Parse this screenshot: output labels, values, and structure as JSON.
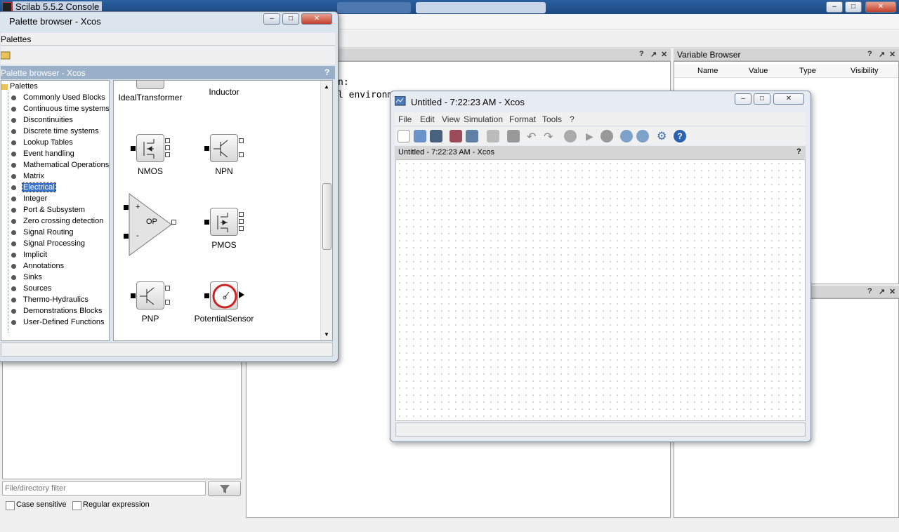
{
  "console": {
    "title": "Scilab 5.5.2 Console",
    "console_text_line1": "n:",
    "console_text_line2": "l environm",
    "variable_browser": {
      "title": "Variable Browser",
      "columns": [
        "Name",
        "Value",
        "Type",
        "Visibility"
      ]
    },
    "file_filter_placeholder": "File/directory filter",
    "case_sensitive_label": "Case sensitive",
    "regex_label": "Regular expression",
    "dock_help": "?",
    "dock_undock": "↗",
    "dock_close": "✕"
  },
  "palette_browser": {
    "title": "Palette browser - Xcos",
    "menu_label": "Palettes",
    "panel_title": "Palette browser - Xcos",
    "help": "?",
    "tree_root": "Palettes",
    "tree_items": [
      "Commonly Used Blocks",
      "Continuous time systems",
      "Discontinuities",
      "Discrete time systems",
      "Lookup Tables",
      "Event handling",
      "Mathematical Operations",
      "Matrix",
      "Electrical",
      "Integer",
      "Port & Subsystem",
      "Zero crossing detection",
      "Signal Routing",
      "Signal Processing",
      "Implicit",
      "Annotations",
      "Sinks",
      "Sources",
      "Thermo-Hydraulics",
      "Demonstrations Blocks",
      "User-Defined Functions"
    ],
    "selected_item": "Electrical",
    "blocks": {
      "ideal_transformer": "IdealTransformer",
      "inductor": "Inductor",
      "nmos": "NMOS",
      "npn": "NPN",
      "opamp": "OP",
      "opamp_plus": "+",
      "opamp_minus": "-",
      "pmos": "PMOS",
      "pnp": "PNP",
      "potential_sensor": "PotentialSensor"
    }
  },
  "xcos": {
    "title": "Untitled - 7:22:23 AM - Xcos",
    "menu": [
      "File",
      "Edit",
      "View",
      "Simulation",
      "Format",
      "Tools",
      "?"
    ],
    "diagram_tab": "Untitled - 7:22:23 AM - Xcos",
    "help": "?"
  }
}
